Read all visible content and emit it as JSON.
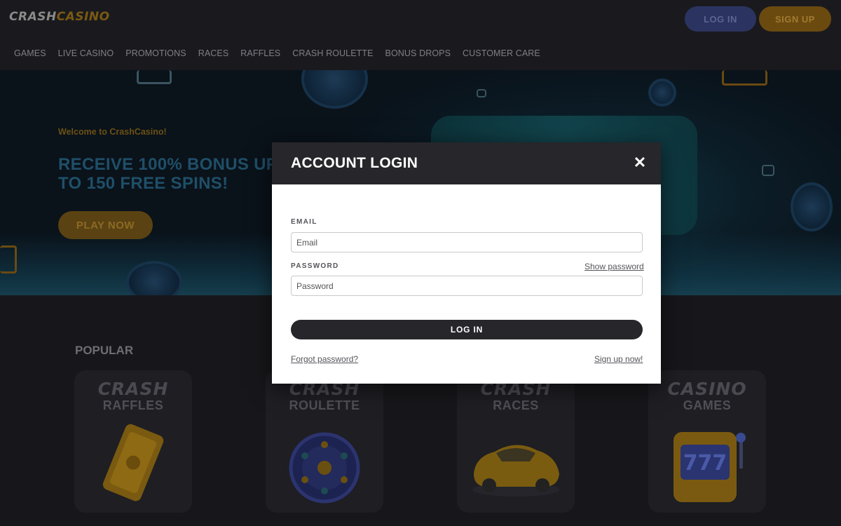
{
  "header": {
    "logo_part1": "CRASH",
    "logo_part2": "CASINO",
    "login_label": "LOG IN",
    "signup_label": "SIGN UP"
  },
  "nav": {
    "items": [
      {
        "label": "GAMES"
      },
      {
        "label": "LIVE CASINO"
      },
      {
        "label": "PROMOTIONS"
      },
      {
        "label": "RACES"
      },
      {
        "label": "RAFFLES"
      },
      {
        "label": "CRASH ROULETTE"
      },
      {
        "label": "BONUS DROPS"
      },
      {
        "label": "CUSTOMER CARE"
      }
    ]
  },
  "hero": {
    "welcome": "Welcome to CrashCasino!",
    "title": "RECEIVE 100% BONUS UP TO 150 FREE SPINS!",
    "play_label": "PLAY NOW"
  },
  "popular": {
    "title": "POPULAR",
    "cards": [
      {
        "line1": "CRASH",
        "line2": "RAFFLES",
        "icon": "ticket-icon"
      },
      {
        "line1": "CRASH",
        "line2": "ROULETTE",
        "icon": "roulette-wheel-icon"
      },
      {
        "line1": "CRASH",
        "line2": "RACES",
        "icon": "race-car-icon"
      },
      {
        "line1": "CASINO",
        "line2": "GAMES",
        "icon": "slot-machine-icon"
      }
    ]
  },
  "modal": {
    "title": "ACCOUNT LOGIN",
    "close_icon": "close-icon",
    "email_label": "EMAIL",
    "email_placeholder": "Email",
    "email_value": "",
    "password_label": "PASSWORD",
    "show_password": "Show password",
    "password_placeholder": "Password",
    "password_value": "",
    "submit_label": "LOG IN",
    "forgot_password": "Forgot password?",
    "signup_now": "Sign up now!"
  },
  "colors": {
    "accent_gold": "#c98f1c",
    "accent_blue": "#3e4fa0",
    "modal_header": "#26262b",
    "page_bg": "#17171b"
  }
}
